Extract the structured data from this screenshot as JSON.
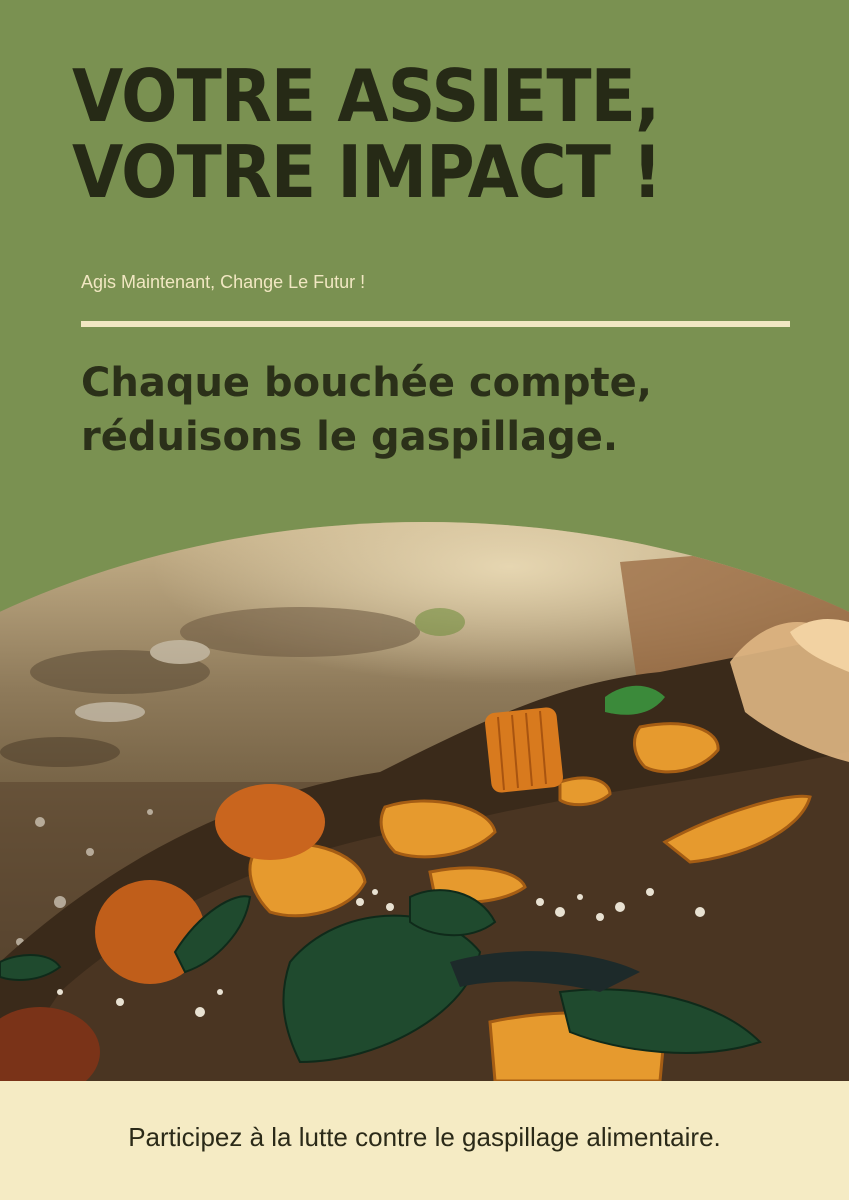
{
  "headline": {
    "line1": "VOTRE ASSIETE,",
    "line2": "VOTRE IMPACT !"
  },
  "tagline": "Agis Maintenant, Change Le Futur !",
  "subheadline": {
    "line1": "Chaque bouchée compte,",
    "line2": "réduisons le gaspillage."
  },
  "image": {
    "subject": "food-waste-pile-photo"
  },
  "footer": {
    "text": "Participez à la lutte contre le gaspillage alimentaire."
  },
  "colors": {
    "background": "#7a9151",
    "headline": "#262a16",
    "accent_cream": "#f1e7c2",
    "footer_bg": "#f5ebc4"
  }
}
